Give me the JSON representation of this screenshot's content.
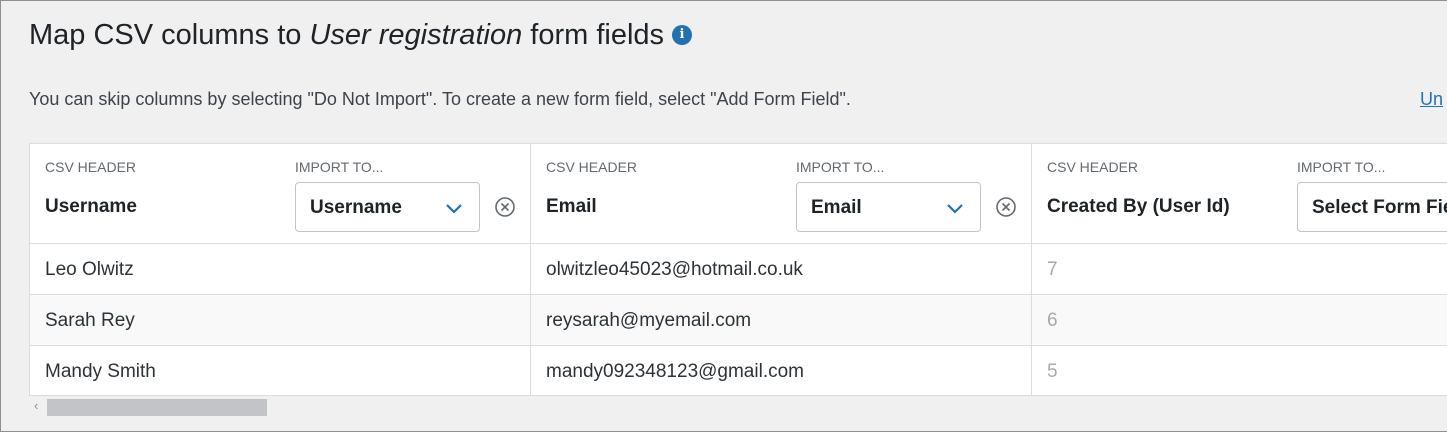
{
  "header": {
    "title_prefix": "Map CSV columns to ",
    "title_form": "User registration",
    "title_suffix": " form fields",
    "info_glyph": "i",
    "subtitle": "You can skip columns by selecting \"Do Not Import\". To create a new form field, select \"Add Form Field\".",
    "undo_link": "Un"
  },
  "table": {
    "columns": [
      {
        "csv_label": "CSV HEADER",
        "import_label": "IMPORT TO...",
        "csv_header": "Username",
        "selected_field": "Username",
        "rows": [
          "Leo Olwitz",
          "Sarah Rey",
          "Mandy Smith"
        ]
      },
      {
        "csv_label": "CSV HEADER",
        "import_label": "IMPORT TO...",
        "csv_header": "Email",
        "selected_field": "Email",
        "rows": [
          "olwitzleo45023@hotmail.co.uk",
          "reysarah@myemail.com",
          "mandy092348123@gmail.com"
        ]
      },
      {
        "csv_label": "CSV HEADER",
        "import_label": "IMPORT TO...",
        "csv_header": "Created By (User Id)",
        "selected_field": "Select Form Field",
        "rows": [
          "7",
          "6",
          "5"
        ]
      }
    ]
  },
  "scrollbar": {
    "left_arrow": "‹"
  },
  "colors": {
    "accent": "#2271b1",
    "background": "#f0f0f1",
    "border": "#dcdcde",
    "muted": "#a7aaad"
  }
}
